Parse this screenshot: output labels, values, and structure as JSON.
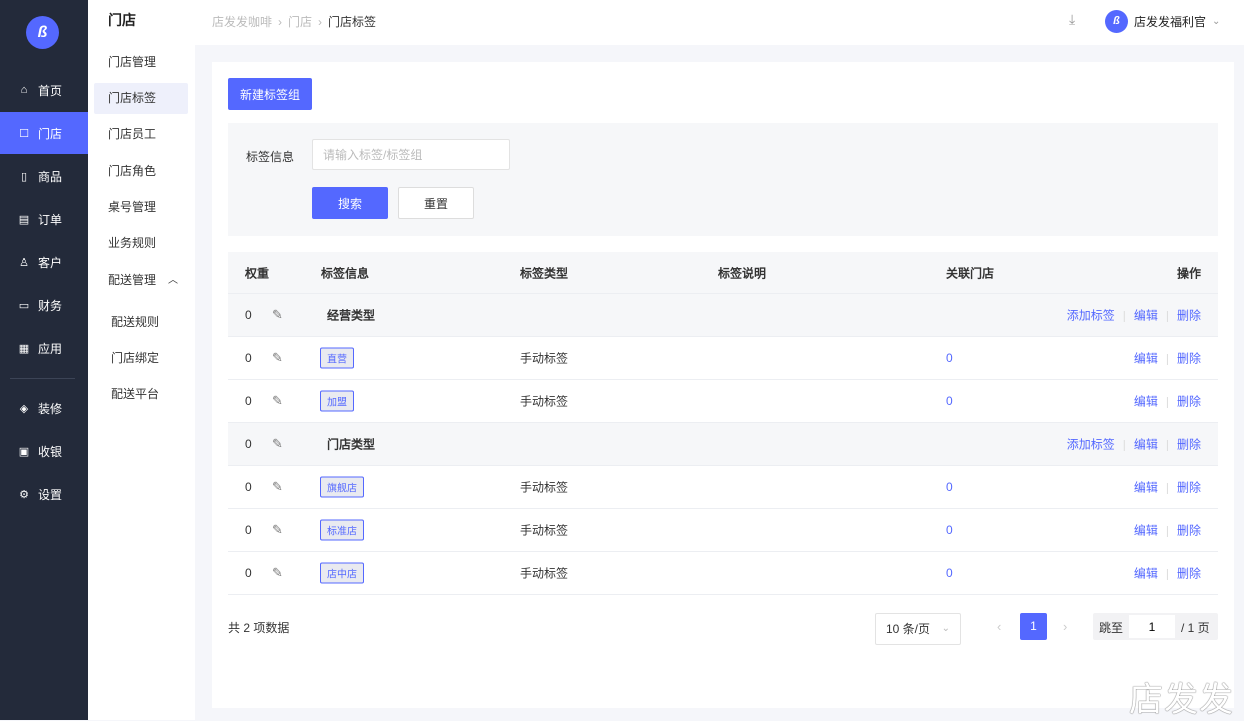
{
  "sidebar": {
    "logo": "ß",
    "items": [
      {
        "label": "首页",
        "icon": "home-icon",
        "glyph": "⌂"
      },
      {
        "label": "门店",
        "icon": "store-icon",
        "glyph": "☐",
        "active": true
      },
      {
        "label": "商品",
        "icon": "bag-icon",
        "glyph": "▯"
      },
      {
        "label": "订单",
        "icon": "order-icon",
        "glyph": "▤"
      },
      {
        "label": "客户",
        "icon": "user-icon",
        "glyph": "♙"
      },
      {
        "label": "财务",
        "icon": "wallet-icon",
        "glyph": "▭"
      },
      {
        "label": "应用",
        "icon": "apps-icon",
        "glyph": "▦"
      },
      {
        "label": "装修",
        "icon": "layers-icon",
        "glyph": "◈"
      },
      {
        "label": "收银",
        "icon": "cashier-icon",
        "glyph": "▣"
      },
      {
        "label": "设置",
        "icon": "gear-icon",
        "glyph": "⚙"
      }
    ]
  },
  "subnav": {
    "title": "门店",
    "items": [
      "门店管理",
      "门店标签",
      "门店员工",
      "门店角色",
      "桌号管理",
      "业务规则",
      "配送管理"
    ],
    "delivery_children": [
      "配送规则",
      "门店绑定",
      "配送平台"
    ]
  },
  "header": {
    "breadcrumb": [
      "店发发咖啡",
      "门店",
      "门店标签"
    ],
    "user": "店发发福利官"
  },
  "toolbar": {
    "new_group": "新建标签组"
  },
  "filter": {
    "label": "标签信息",
    "placeholder": "请输入标签/标签组",
    "value": "",
    "search": "搜索",
    "reset": "重置"
  },
  "table": {
    "columns": [
      "权重",
      "标签信息",
      "标签类型",
      "标签说明",
      "关联门店",
      "操作"
    ],
    "rows": [
      {
        "group": true,
        "weight": "0",
        "name": "经营类型",
        "ops": [
          "添加标签",
          "编辑",
          "删除"
        ]
      },
      {
        "weight": "0",
        "name": "直营",
        "type": "手动标签",
        "desc": "",
        "stores": "0",
        "ops": [
          "编辑",
          "删除"
        ]
      },
      {
        "weight": "0",
        "name": "加盟",
        "type": "手动标签",
        "desc": "",
        "stores": "0",
        "ops": [
          "编辑",
          "删除"
        ]
      },
      {
        "group": true,
        "weight": "0",
        "name": "门店类型",
        "ops": [
          "添加标签",
          "编辑",
          "删除"
        ]
      },
      {
        "weight": "0",
        "name": "旗舰店",
        "type": "手动标签",
        "desc": "",
        "stores": "0",
        "ops": [
          "编辑",
          "删除"
        ]
      },
      {
        "weight": "0",
        "name": "标准店",
        "type": "手动标签",
        "desc": "",
        "stores": "0",
        "ops": [
          "编辑",
          "删除"
        ]
      },
      {
        "weight": "0",
        "name": "店中店",
        "type": "手动标签",
        "desc": "",
        "stores": "0",
        "ops": [
          "编辑",
          "删除"
        ]
      }
    ]
  },
  "pagination": {
    "total": "共 2 项数据",
    "page_size": "10 条/页",
    "current": "1",
    "jump_label": "跳至",
    "jump_value": "1",
    "total_pages": "/ 1 页"
  },
  "watermark": "店发发",
  "colors": {
    "accent": "#5468ff",
    "sidebar": "#232a3a"
  }
}
